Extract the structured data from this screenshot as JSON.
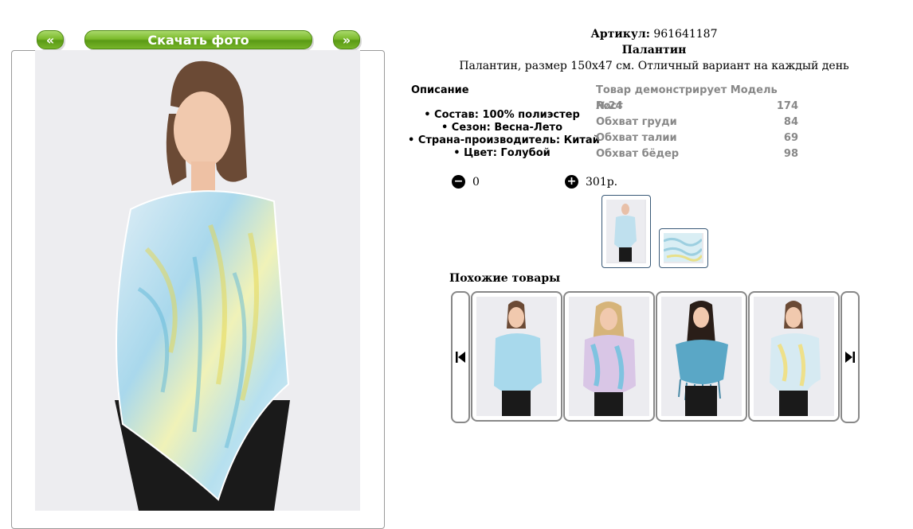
{
  "gallery": {
    "prev_label": "«",
    "download_label": "Скачать фото",
    "next_label": "»"
  },
  "product": {
    "article_label": "Артикул:",
    "article_value": "961641187",
    "name": "Палантин",
    "description": "Палантин, размер 150x47 см. Отличный вариант на каждый день"
  },
  "description": {
    "title": "Описание",
    "items": [
      "• Состав: 100% полиэстер",
      "• Сезон: Весна-Лето",
      "• Страна-производитель: Китай",
      "• Цвет: Голубой"
    ]
  },
  "model": {
    "title": "Товар демонстрирует Модель №24",
    "rows": [
      {
        "label": "Рост",
        "value": "174"
      },
      {
        "label": "Обхват груди",
        "value": "84"
      },
      {
        "label": "Обхват талии",
        "value": "69"
      },
      {
        "label": "Обхват бёдер",
        "value": "98"
      }
    ]
  },
  "order": {
    "minus_icon": "minus-circle-icon",
    "quantity": "0",
    "plus_icon": "plus-circle-icon",
    "price": "301р."
  },
  "similar": {
    "title": "Похожие товары"
  },
  "colors": {
    "button_green": "#7cbb2c",
    "thumb_border": "#3a5a78",
    "model_text": "#888888"
  }
}
